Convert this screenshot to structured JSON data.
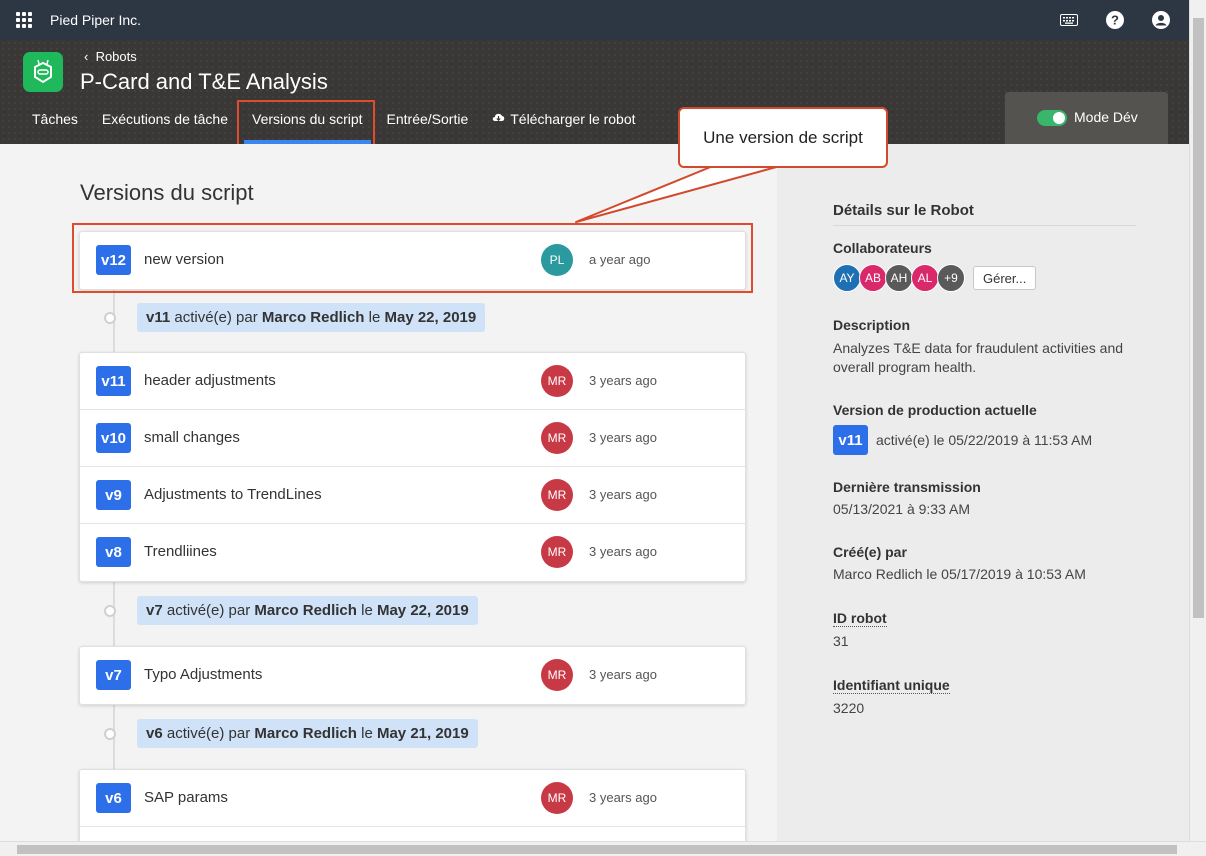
{
  "topbar": {
    "org_name": "Pied Piper Inc."
  },
  "header": {
    "back_label": "Robots",
    "robot_title": "P-Card and T&E Analysis",
    "tabs": [
      {
        "label": "Tâches"
      },
      {
        "label": "Exécutions de tâche"
      },
      {
        "label": "Versions du script",
        "active": true
      },
      {
        "label": "Entrée/Sortie"
      },
      {
        "label": "Télécharger le robot"
      }
    ],
    "dev_mode_label": "Mode Dév"
  },
  "callout": {
    "text": "Une version de script"
  },
  "main": {
    "section_title": "Versions du script",
    "latest": {
      "badge": "v12",
      "name": "new version",
      "avatar": "PL",
      "ago": "a year ago"
    },
    "activations": [
      {
        "version": "v11",
        "by_label": "activé(e) par",
        "user": "Marco Redlich",
        "on_label": "le",
        "date": "May 22, 2019"
      },
      {
        "version": "v7",
        "by_label": "activé(e) par",
        "user": "Marco Redlich",
        "on_label": "le",
        "date": "May 22, 2019"
      },
      {
        "version": "v6",
        "by_label": "activé(e) par",
        "user": "Marco Redlich",
        "on_label": "le",
        "date": "May 21, 2019"
      }
    ],
    "group1": [
      {
        "badge": "v11",
        "name": "header adjustments",
        "avatar": "MR",
        "ago": "3 years ago"
      },
      {
        "badge": "v10",
        "name": "small changes",
        "avatar": "MR",
        "ago": "3 years ago"
      },
      {
        "badge": "v9",
        "name": "Adjustments to TrendLines",
        "avatar": "MR",
        "ago": "3 years ago"
      },
      {
        "badge": "v8",
        "name": "Trendliines",
        "avatar": "MR",
        "ago": "3 years ago"
      }
    ],
    "group2": [
      {
        "badge": "v7",
        "name": "Typo Adjustments",
        "avatar": "MR",
        "ago": "3 years ago"
      }
    ],
    "group3": [
      {
        "badge": "v6",
        "name": "SAP params",
        "avatar": "MR",
        "ago": "3 years ago"
      }
    ]
  },
  "side": {
    "title": "Détails sur le Robot",
    "collaborators_label": "Collaborateurs",
    "collaborators": [
      {
        "initials": "AY",
        "color": "#1f6fb5"
      },
      {
        "initials": "AB",
        "color": "#d9296a"
      },
      {
        "initials": "AH",
        "color": "#5a5a5a"
      },
      {
        "initials": "AL",
        "color": "#d9296a"
      },
      {
        "initials": "+9",
        "color": "#5a5a5a"
      }
    ],
    "manage_label": "Gérer...",
    "description_label": "Description",
    "description": "Analyzes T&E data for fraudulent activities and overall program health.",
    "prod_label": "Version de production actuelle",
    "prod_badge": "v11",
    "prod_text": "activé(e) le 05/22/2019 à 11:53 AM",
    "last_label": "Dernière transmission",
    "last_value": "05/13/2021 à 9:33 AM",
    "created_label": "Créé(e) par",
    "created_value": "Marco Redlich le 05/17/2019 à 10:53 AM",
    "id_label": "ID robot",
    "id_value": "31",
    "uid_label": "Identifiant unique",
    "uid_value": "3220"
  }
}
